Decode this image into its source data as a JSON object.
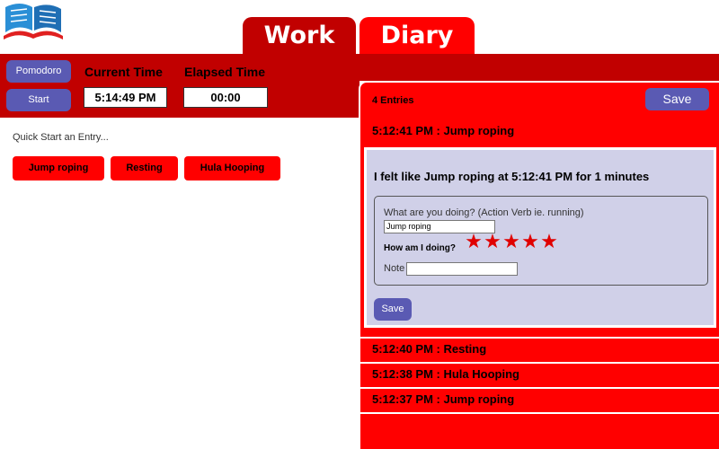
{
  "app": {
    "logo_icon": "open-book-logo-icon"
  },
  "tabs": [
    {
      "label": "Work"
    },
    {
      "label": "Diary"
    }
  ],
  "timer": {
    "pomodoro_label": "Pomodoro",
    "start_label": "Start",
    "current_time_label": "Current Time",
    "current_time_value": "5:14:49 PM",
    "elapsed_time_label": "Elapsed Time",
    "elapsed_time_value": "00:00"
  },
  "quick_start": {
    "label": "Quick Start an Entry...",
    "buttons": [
      "Jump roping",
      "Resting",
      "Hula Hooping"
    ]
  },
  "diary": {
    "entries_count": "4 Entries",
    "save_label": "Save",
    "expanded_entry": {
      "title": "5:12:41 PM : Jump roping",
      "heading": "I felt like Jump roping at 5:12:41 PM for 1 minutes",
      "question_label": "What are you doing? (Action Verb ie. running)",
      "action_value": "Jump roping",
      "how_label": "How am I doing?",
      "rating": 5,
      "rating_max": 5,
      "note_label": "Note",
      "note_value": "",
      "save_label": "Save"
    },
    "entries": [
      {
        "title": "5:12:40 PM : Resting"
      },
      {
        "title": "5:12:38 PM : Hula Hooping"
      },
      {
        "title": "5:12:37 PM : Jump roping"
      }
    ]
  },
  "colors": {
    "primary_red": "#ff0000",
    "dark_red": "#c10000",
    "button_purple": "#5a5ab3",
    "card_lavender": "#d0d0e8",
    "star_red": "#e00000"
  }
}
